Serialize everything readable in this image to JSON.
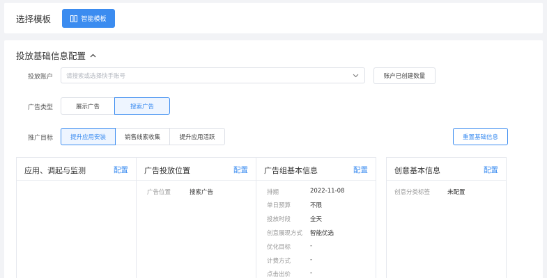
{
  "top": {
    "title": "选择模板",
    "smart_template_button": "智能模板"
  },
  "base_config": {
    "title": "投放基础信息配置",
    "account": {
      "label": "投放账户",
      "placeholder": "请搜索或选择快手账号",
      "created_count_button": "账户已创建数量"
    },
    "ad_type": {
      "label": "广告类型",
      "options": [
        "展示广告",
        "搜索广告"
      ],
      "selected": "搜索广告"
    },
    "goal": {
      "label": "推广目标",
      "options": [
        "提升应用安装",
        "销售线索收集",
        "提升应用活跃"
      ],
      "selected": "提升应用安装"
    },
    "reset_button": "重置基础信息"
  },
  "panels": [
    {
      "title": "应用、调起与监测",
      "link": "配置",
      "rows": []
    },
    {
      "title": "广告投放位置",
      "link": "配置",
      "rows": [
        {
          "key": "广告位置",
          "value": "搜索广告"
        }
      ]
    },
    {
      "title": "广告组基本信息",
      "link": "配置",
      "rows": [
        {
          "key": "排期",
          "value": "2022-11-08"
        },
        {
          "key": "单日预算",
          "value": "不限"
        },
        {
          "key": "投放时段",
          "value": "全天"
        },
        {
          "key": "创意展现方式",
          "value": "智能优选"
        },
        {
          "key": "优化目标",
          "value": "-"
        },
        {
          "key": "计费方式",
          "value": "-"
        },
        {
          "key": "点击出价",
          "value": "-"
        }
      ]
    },
    {
      "title": "创意基本信息",
      "link": "配置",
      "rows": [
        {
          "key": "创意分类标签",
          "value": "未配置"
        }
      ]
    }
  ],
  "colors": {
    "accent": "#3b8cf0",
    "background": "#f2f3f6",
    "border": "#dcdfe6"
  }
}
